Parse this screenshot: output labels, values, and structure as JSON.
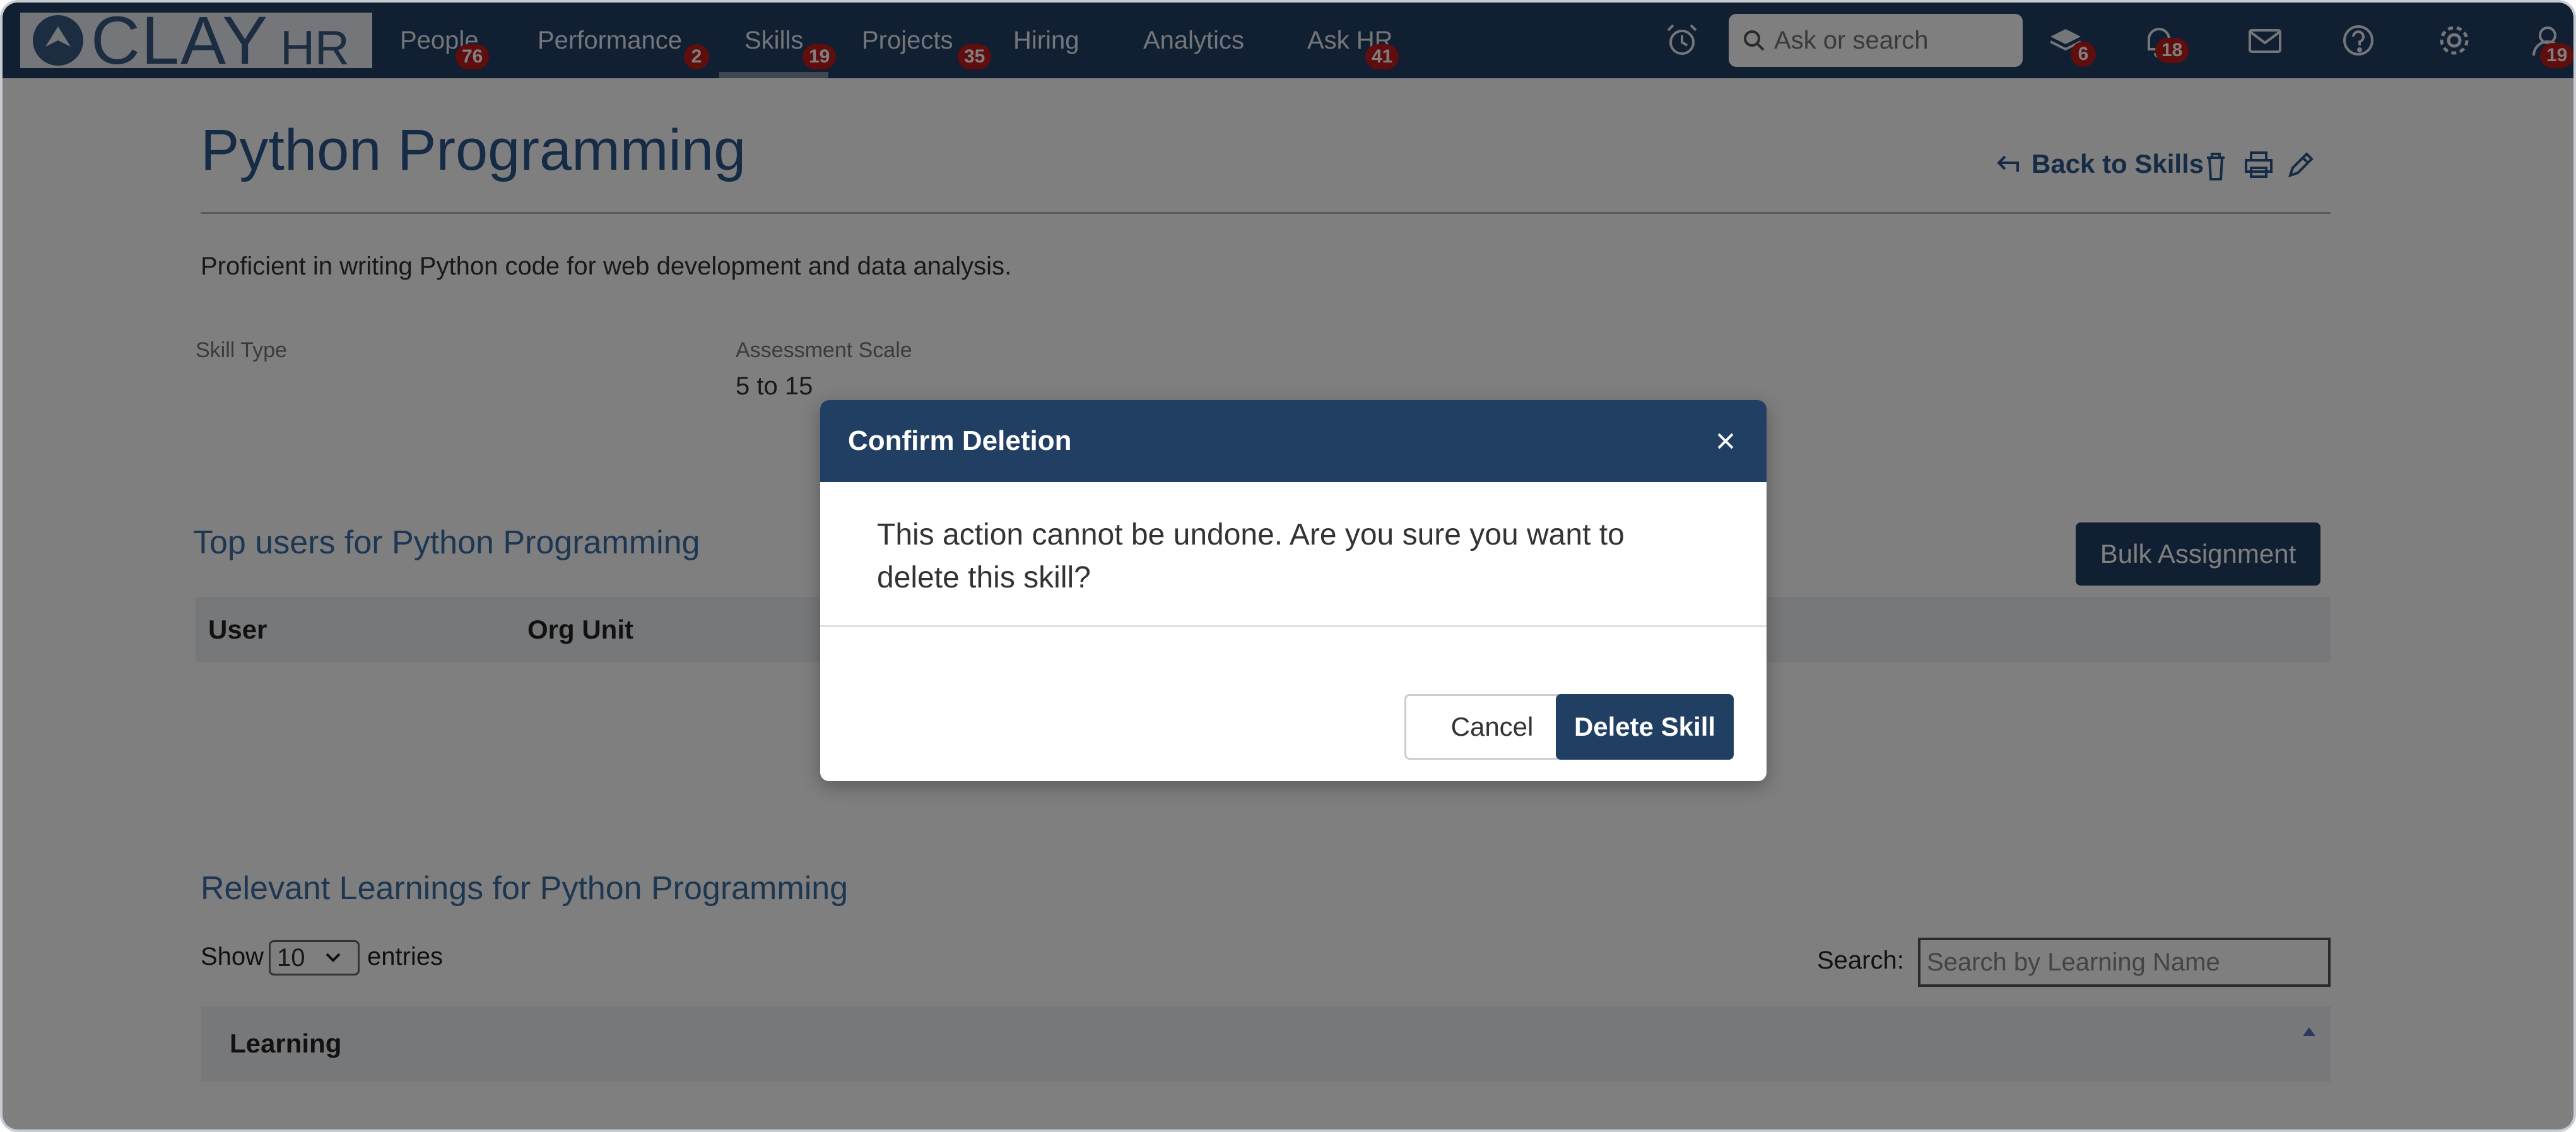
{
  "navbar": {
    "logo": "CLAY",
    "logo_hr": "HR",
    "items": [
      {
        "label": "People",
        "badge": "76"
      },
      {
        "label": "Performance",
        "badge": "2"
      },
      {
        "label": "Skills",
        "badge": "19"
      },
      {
        "label": "Projects",
        "badge": "35"
      },
      {
        "label": "Hiring",
        "badge": ""
      },
      {
        "label": "Analytics",
        "badge": ""
      },
      {
        "label": "Ask HR",
        "badge": "41"
      }
    ],
    "search_placeholder": "Ask or search",
    "icon_badges": {
      "learning": "6",
      "notifications": "18",
      "profile": "19"
    }
  },
  "page": {
    "title": "Python Programming",
    "back_label": "Back to Skills",
    "description": "Proficient in writing Python code for web development and data analysis.",
    "skill_type_label": "Skill Type",
    "assessment_label": "Assessment Scale",
    "assessment_value": "5 to 15",
    "top_users_title": "Top users for Python Programming",
    "bulk_label": "Bulk Assignment",
    "table_headers": [
      "User",
      "Org Unit"
    ],
    "learnings_title": "Relevant Learnings for Python Programming",
    "show_label": "Show",
    "show_value": "10",
    "entries_label": "entries",
    "search_label": "Search:",
    "search_placeholder": "Search by Learning Name",
    "learning_header": "Learning"
  },
  "modal": {
    "title": "Confirm Deletion",
    "body": "This action cannot be undone. Are you sure you want to delete this skill?",
    "cancel_label": "Cancel",
    "delete_label": "Delete Skill"
  },
  "colors": {
    "navy": "#213f63",
    "link": "#2a568c",
    "badge": "#c01b1b"
  }
}
